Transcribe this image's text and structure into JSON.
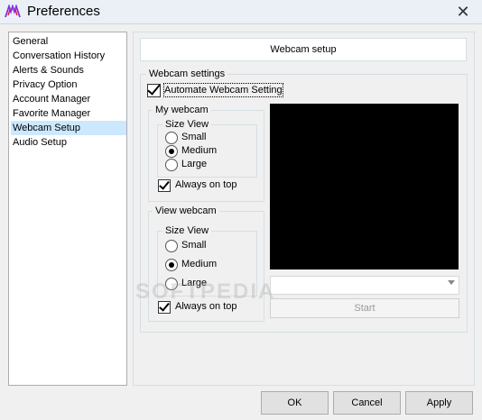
{
  "window": {
    "title": "Preferences",
    "close_glyph": "✕"
  },
  "nav": {
    "items": [
      {
        "label": "General"
      },
      {
        "label": "Conversation History"
      },
      {
        "label": "Alerts & Sounds"
      },
      {
        "label": "Privacy Option"
      },
      {
        "label": "Account Manager"
      },
      {
        "label": "Favorite Manager"
      },
      {
        "label": "Webcam Setup",
        "selected": true
      },
      {
        "label": "Audio Setup"
      }
    ]
  },
  "panel": {
    "header": "Webcam setup",
    "webcam_settings": {
      "label": "Webcam settings",
      "automate_label": "Automate Webcam Setting",
      "automate_checked": true
    },
    "my_webcam": {
      "label": "My webcam",
      "size_view_label": "Size View",
      "options": [
        "Small",
        "Medium",
        "Large"
      ],
      "selected": "Medium",
      "always_on_top_label": "Always on top",
      "always_on_top_checked": true
    },
    "view_webcam": {
      "label": "View webcam",
      "size_view_label": "Size View",
      "options": [
        "Small",
        "Medium",
        "Large"
      ],
      "selected": "Medium",
      "always_on_top_label": "Always on top",
      "always_on_top_checked": true
    },
    "device_select_value": "",
    "start_label": "Start"
  },
  "buttons": {
    "ok": "OK",
    "cancel": "Cancel",
    "apply": "Apply"
  },
  "watermark": "SOFTPEDIA"
}
